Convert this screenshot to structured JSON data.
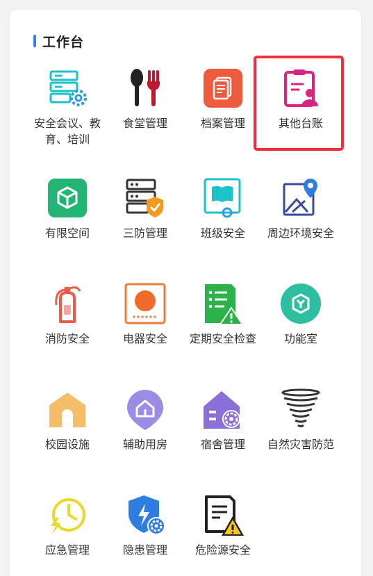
{
  "section": {
    "title": "工作台"
  },
  "items": [
    {
      "label": "安全会议、教育、培训",
      "icon": "server-gear-icon"
    },
    {
      "label": "食堂管理",
      "icon": "spoon-fork-icon"
    },
    {
      "label": "档案管理",
      "icon": "document-icon"
    },
    {
      "label": "其他台账",
      "icon": "clipboard-user-icon"
    },
    {
      "label": "有限空间",
      "icon": "cube-icon"
    },
    {
      "label": "三防管理",
      "icon": "server-shield-icon"
    },
    {
      "label": "班级安全",
      "icon": "book-icon"
    },
    {
      "label": "周边环境安全",
      "icon": "map-pin-icon"
    },
    {
      "label": "消防安全",
      "icon": "fire-extinguisher-icon"
    },
    {
      "label": "电器安全",
      "icon": "appliance-icon"
    },
    {
      "label": "定期安全检查",
      "icon": "checklist-warning-icon"
    },
    {
      "label": "功能室",
      "icon": "room-icon"
    },
    {
      "label": "校园设施",
      "icon": "arch-icon"
    },
    {
      "label": "辅助用房",
      "icon": "house-pin-icon"
    },
    {
      "label": "宿舍管理",
      "icon": "dorm-gear-icon"
    },
    {
      "label": "自然灾害防范",
      "icon": "tornado-icon"
    },
    {
      "label": "应急管理",
      "icon": "clock-bolt-icon"
    },
    {
      "label": "隐患管理",
      "icon": "shield-gear-icon"
    },
    {
      "label": "危险源安全",
      "icon": "warning-doc-icon"
    }
  ],
  "colors": {
    "accent": "#3d7bf7",
    "highlight": "#ef2f3a",
    "teal": "#19c3c9",
    "green": "#22b573",
    "orange": "#f07a3a",
    "pink": "#d8267e",
    "blue": "#2f7de0"
  }
}
